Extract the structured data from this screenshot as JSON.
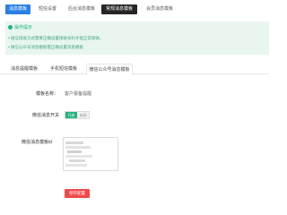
{
  "topnav": {
    "items": [
      "消息模板",
      "短信设置",
      "后台消息模板",
      "常规消息模板",
      "会员消息模板"
    ]
  },
  "notice": {
    "title": "操作提示",
    "lines": [
      "• 短信接收方式需要正确设置接收号码才能正常接收。",
      "• 微信公众号消息模板需正确设置消息模板"
    ]
  },
  "tabs": [
    "消息提醒模板",
    "手机短信模板",
    "微信公众号消息模板"
  ],
  "form": {
    "template_name_label": "模板名称：",
    "template_name_value": "客户报备提醒",
    "switch_label": "微信消息开关",
    "switch_on": "开启",
    "switch_off": "关闭",
    "template_id_label": "微信消息模板id",
    "save_button": "保存配置"
  },
  "colors": {
    "primary": "#2a7fe6",
    "dark": "#252525",
    "success": "#22b07d",
    "danger": "#f0484a",
    "notice_bg": "#e8f6ef"
  }
}
